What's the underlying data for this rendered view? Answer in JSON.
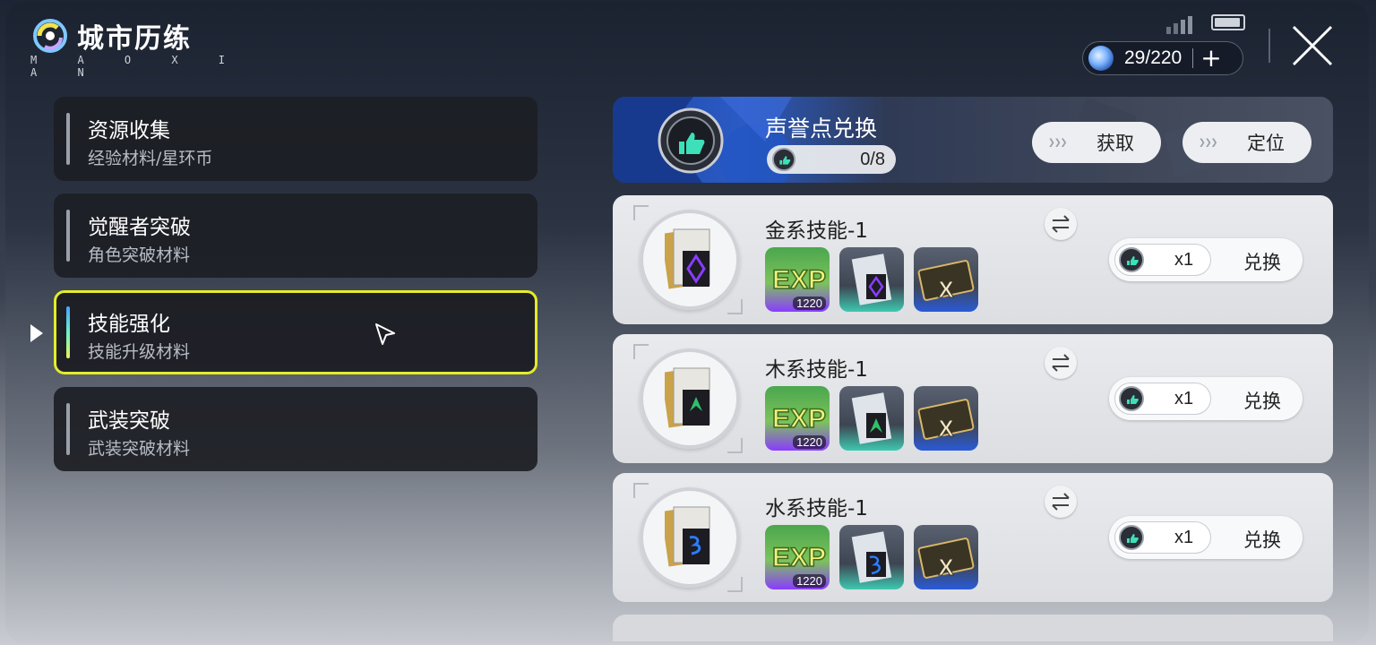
{
  "header": {
    "title": "城市历练",
    "subtitle": "M A O X I A N",
    "stamina": "29/220",
    "stamina_add": "+"
  },
  "menu": [
    {
      "title": "资源收集",
      "sub": "经验材料/星环币",
      "active": false
    },
    {
      "title": "觉醒者突破",
      "sub": "角色突破材料",
      "active": false
    },
    {
      "title": "技能强化",
      "sub": "技能升级材料",
      "active": true
    },
    {
      "title": "武装突破",
      "sub": "武装突破材料",
      "active": false
    }
  ],
  "reputation": {
    "title": "声誉点兑换",
    "value": "0/8",
    "get_label": "获取",
    "locate_label": "定位",
    "btn_chevrons": "❯❯❯"
  },
  "cards": [
    {
      "name": "金系技能-1",
      "exp_count": "1220",
      "qty": "x1",
      "exchange_label": "兑换",
      "element_color": "#8a3cff"
    },
    {
      "name": "木系技能-1",
      "exp_count": "1220",
      "qty": "x1",
      "exchange_label": "兑换",
      "element_color": "#2fbf6a"
    },
    {
      "name": "水系技能-1",
      "exp_count": "1220",
      "qty": "x1",
      "exchange_label": "兑换",
      "element_color": "#2a7dff"
    }
  ],
  "icons": {
    "logo": "city-logo-icon",
    "stamina": "stamina-orb-icon",
    "close": "close-icon",
    "swap": "swap-arrows-icon",
    "coin": "reputation-coin-icon"
  },
  "colors": {
    "active_border": "#e4ec2a",
    "banner_blue": "#2a5ac4"
  }
}
